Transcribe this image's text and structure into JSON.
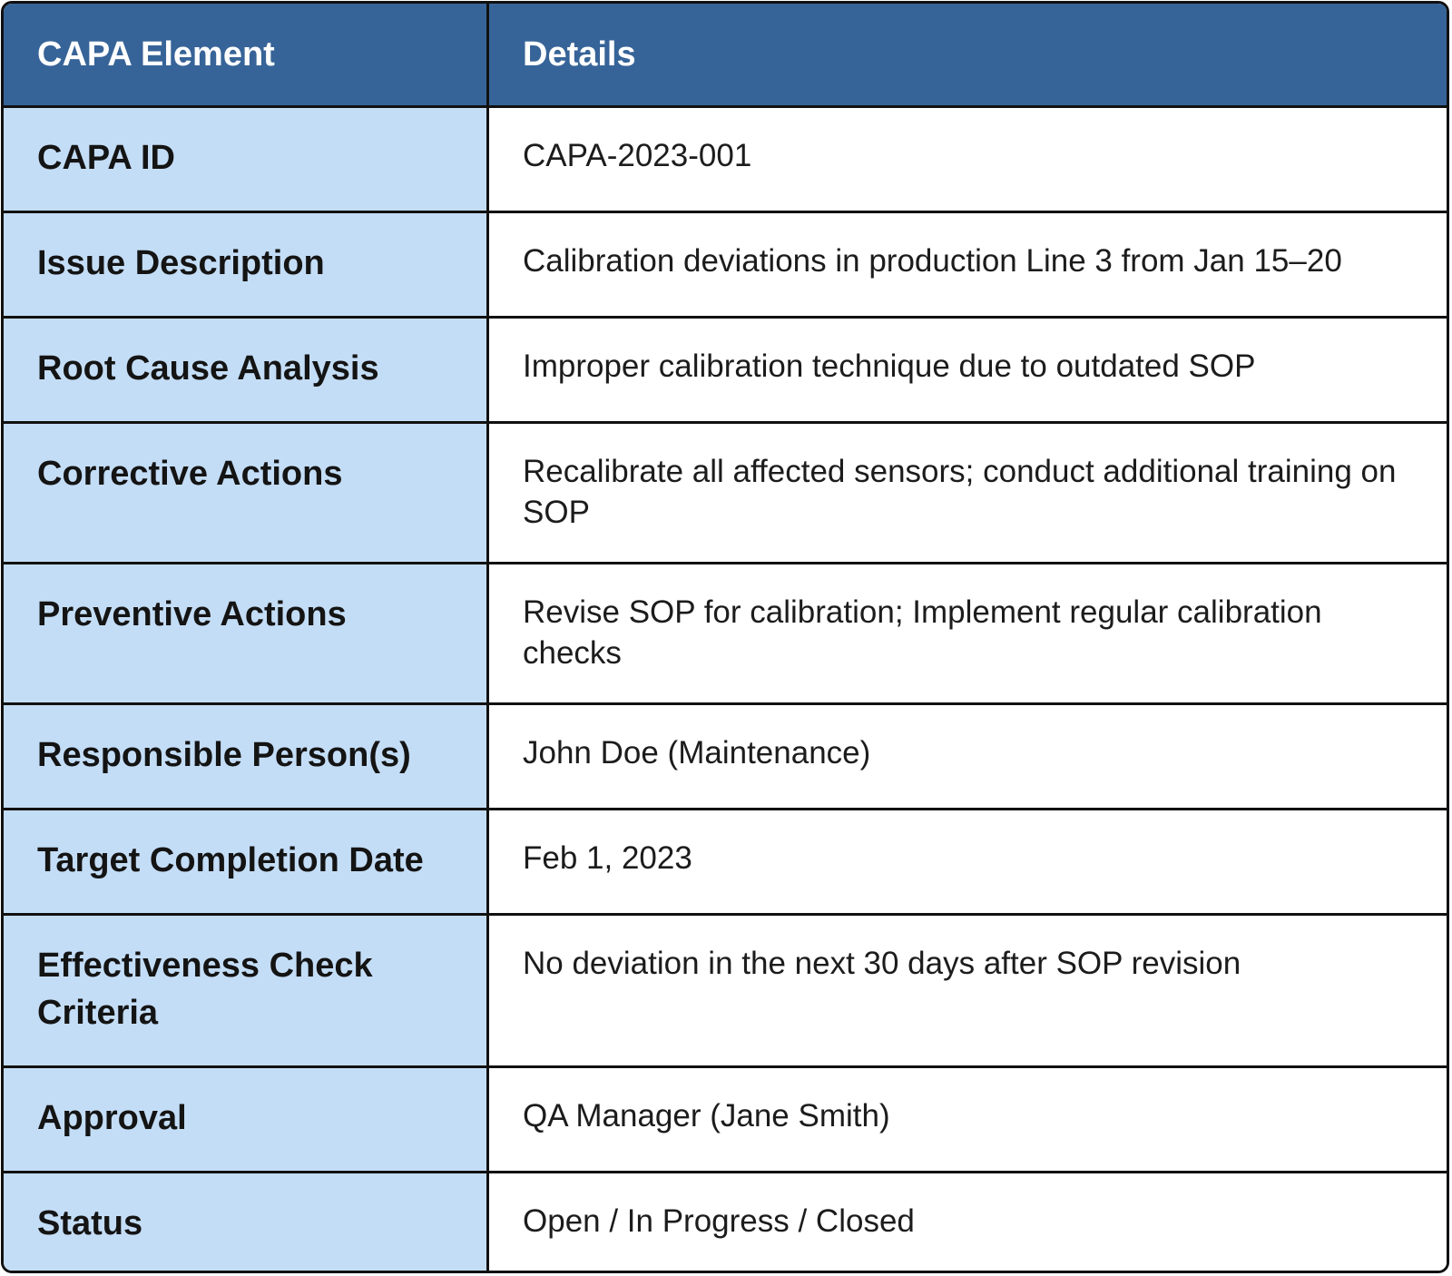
{
  "table": {
    "headers": {
      "element": "CAPA Element",
      "details": "Details"
    },
    "rows": [
      {
        "element": "CAPA ID",
        "details": "CAPA-2023-001"
      },
      {
        "element": "Issue Description",
        "details": "Calibration deviations in production Line 3 from Jan 15–20"
      },
      {
        "element": "Root Cause Analysis",
        "details": "Improper calibration technique due to outdated SOP"
      },
      {
        "element": "Corrective Actions",
        "details": "Recalibrate all affected sensors; conduct additional training on SOP"
      },
      {
        "element": "Preventive Actions",
        "details": "Revise SOP for calibration; Implement regular calibration checks"
      },
      {
        "element": "Responsible Person(s)",
        "details": "John Doe (Maintenance)"
      },
      {
        "element": "Target Completion Date",
        "details": "Feb 1, 2023"
      },
      {
        "element": "Effectiveness Check Criteria",
        "details": "No deviation in the next 30 days after SOP revision"
      },
      {
        "element": "Approval",
        "details": "QA Manager (Jane Smith)"
      },
      {
        "element": "Status",
        "details": "Open / In Progress / Closed"
      }
    ]
  },
  "colors": {
    "header_background": "#376498",
    "label_background": "#c4ddf6",
    "value_background": "#ffffff",
    "border": "#111111"
  }
}
